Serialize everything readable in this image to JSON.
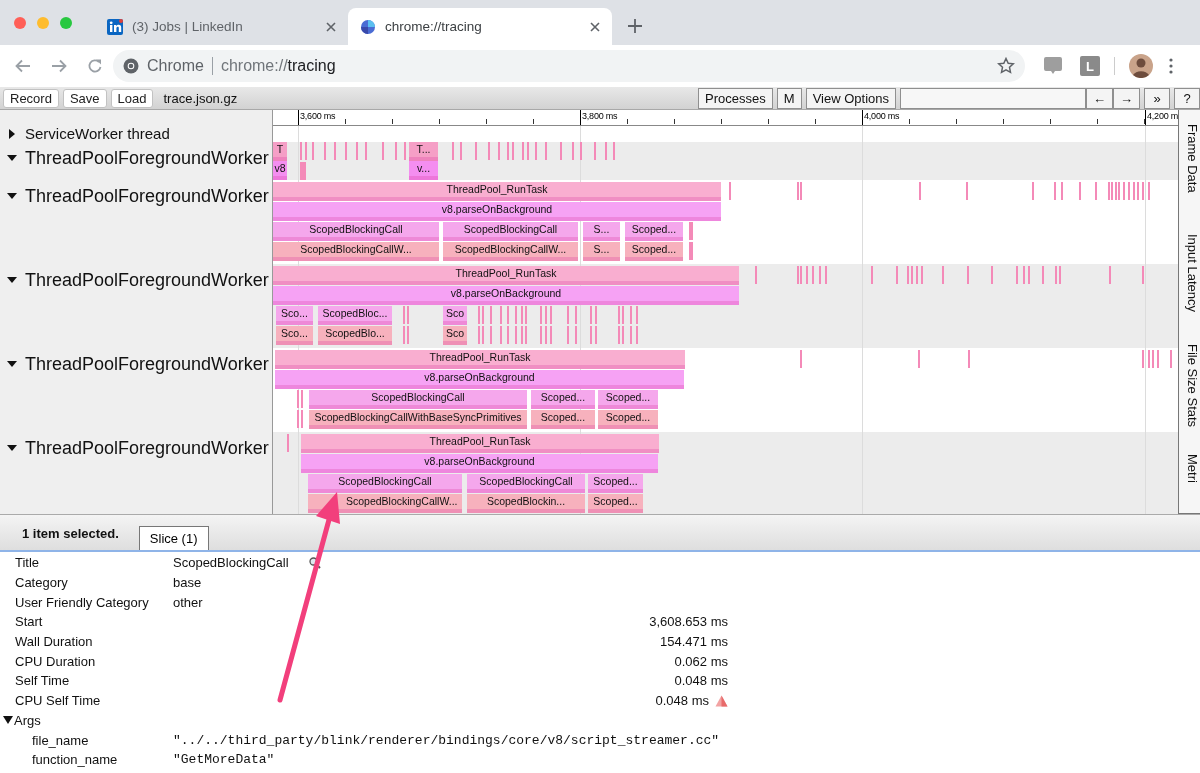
{
  "browser": {
    "tabs": [
      {
        "title": "(3) Jobs | LinkedIn",
        "selected": false
      },
      {
        "title": "chrome://tracing",
        "selected": true
      }
    ],
    "address": {
      "chip": "Chrome",
      "url_scheme": "chrome://",
      "url_path": "tracing"
    },
    "extension_label": "L"
  },
  "toolbar": {
    "buttons": [
      "Record",
      "Save",
      "Load"
    ],
    "file": "trace.json.gz",
    "right_buttons": [
      "Processes",
      "M",
      "View Options"
    ],
    "nav_buttons": [
      "←",
      "→",
      "»",
      "?"
    ]
  },
  "ruler": {
    "ticks": [
      "3,600 ms",
      "3,800 ms",
      "4,000 ms",
      "4,200 m"
    ]
  },
  "tracks": [
    {
      "name": "ServiceWorker thread",
      "expanded": false
    },
    {
      "name": "ThreadPoolForegroundWorker",
      "expanded": true,
      "rows": [
        {
          "slices": [
            {
              "label": "T",
              "color": "#f59fc6"
            },
            {
              "label": "T...",
              "color": "#f59fc6"
            }
          ]
        },
        {
          "slices": [
            {
              "label": "v8",
              "color": "#f48ef0"
            },
            {
              "label": "v...",
              "color": "#f48ef0"
            }
          ]
        }
      ]
    },
    {
      "name": "ThreadPoolForegroundWorker",
      "expanded": true,
      "rows": [
        {
          "slices": [
            {
              "label": "ThreadPool_RunTask",
              "color": "#f9aed0"
            }
          ]
        },
        {
          "slices": [
            {
              "label": "v8.parseOnBackground",
              "color": "#f6a2f4"
            }
          ]
        },
        {
          "slices": [
            {
              "label": "ScopedBlockingCall",
              "color": "#f5a7ec"
            },
            {
              "label": "ScopedBlockingCall",
              "color": "#f5a7ec"
            },
            {
              "label": "S...",
              "color": "#f5a7ec"
            },
            {
              "label": "Scoped...",
              "color": "#f5a7ec"
            }
          ]
        },
        {
          "slices": [
            {
              "label": "ScopedBlockingCallW...",
              "color": "#f7b1bd"
            },
            {
              "label": "ScopedBlockingCallW...",
              "color": "#f7b1bd"
            },
            {
              "label": "S...",
              "color": "#f7b1bd"
            },
            {
              "label": "Scoped...",
              "color": "#f7b1bd"
            }
          ]
        }
      ]
    },
    {
      "name": "ThreadPoolForegroundWorker",
      "expanded": true,
      "rows": [
        {
          "slices": [
            {
              "label": "ThreadPool_RunTask",
              "color": "#f9aed0"
            }
          ]
        },
        {
          "slices": [
            {
              "label": "v8.parseOnBackground",
              "color": "#f6a2f4"
            }
          ]
        },
        {
          "slices": [
            {
              "label": "Sco...",
              "color": "#f5a7ec"
            },
            {
              "label": "ScopedBloc...",
              "color": "#f5a7ec"
            },
            {
              "label": "Sco",
              "color": "#f5a7ec"
            }
          ]
        },
        {
          "slices": [
            {
              "label": "Sco...",
              "color": "#f7b1bd"
            },
            {
              "label": "ScopedBlo...",
              "color": "#f7b1bd"
            },
            {
              "label": "Sco",
              "color": "#f7b1bd"
            }
          ]
        }
      ]
    },
    {
      "name": "ThreadPoolForegroundWorker",
      "expanded": true,
      "rows": [
        {
          "slices": [
            {
              "label": "ThreadPool_RunTask",
              "color": "#f9aed0"
            }
          ]
        },
        {
          "slices": [
            {
              "label": "v8.parseOnBackground",
              "color": "#f6a2f4"
            }
          ]
        },
        {
          "slices": [
            {
              "label": "ScopedBlockingCall",
              "color": "#f5a7ec"
            },
            {
              "label": "Scoped...",
              "color": "#f5a7ec"
            },
            {
              "label": "Scoped...",
              "color": "#f5a7ec"
            }
          ]
        },
        {
          "slices": [
            {
              "label": "ScopedBlockingCallWithBaseSyncPrimitives",
              "color": "#f7b1bd"
            },
            {
              "label": "Scoped...",
              "color": "#f7b1bd"
            },
            {
              "label": "Scoped...",
              "color": "#f7b1bd"
            }
          ]
        }
      ]
    },
    {
      "name": "ThreadPoolForegroundWorker",
      "expanded": true,
      "rows": [
        {
          "slices": [
            {
              "label": "ThreadPool_RunTask",
              "color": "#f9aed0"
            }
          ]
        },
        {
          "slices": [
            {
              "label": "v8.parseOnBackground",
              "color": "#f6a2f4"
            }
          ]
        },
        {
          "slices": [
            {
              "label": "ScopedBlockingCall",
              "color": "#f5a7ec"
            },
            {
              "label": "ScopedBlockingCall",
              "color": "#f5a7ec"
            },
            {
              "label": "Scoped...",
              "color": "#f5a7ec"
            }
          ]
        },
        {
          "slices": [
            {
              "label": "ScopedBlockingCallW...",
              "color": "#f7b1bd"
            },
            {
              "label": "ScopedBlockin...",
              "color": "#f7b1bd"
            },
            {
              "label": "Scoped...",
              "color": "#f7b1bd"
            }
          ]
        }
      ]
    }
  ],
  "side_tabs": [
    {
      "label": "Frame Data",
      "selected": false
    },
    {
      "label": "Input Latency",
      "selected": false
    },
    {
      "label": "File Size Stats",
      "selected": false
    },
    {
      "label": "Metri",
      "selected": false
    }
  ],
  "panel": {
    "status": "1 item selected.",
    "tabs": [
      {
        "label": "Slice (1)",
        "selected": true
      }
    ],
    "fields": [
      {
        "label": "Title",
        "value": "ScopedBlockingCall",
        "kind": "title"
      },
      {
        "label": "Category",
        "value": "base",
        "kind": "text"
      },
      {
        "label": "User Friendly Category",
        "value": "other",
        "kind": "text"
      },
      {
        "label": "Start",
        "value": "3,608.653 ms",
        "kind": "number"
      },
      {
        "label": "Wall Duration",
        "value": "154.471 ms",
        "kind": "number"
      },
      {
        "label": "CPU Duration",
        "value": "0.062 ms",
        "kind": "number"
      },
      {
        "label": "Self Time",
        "value": "0.048 ms",
        "kind": "number"
      },
      {
        "label": "CPU Self Time",
        "value": "0.048 ms",
        "kind": "number",
        "warning": true
      }
    ],
    "args": {
      "label": "Args",
      "expanded": true,
      "items": [
        {
          "label": "file_name",
          "value": "\"../../third_party/blink/renderer/bindings/core/v8/script_streamer.cc\""
        },
        {
          "label": "function_name",
          "value": "\"GetMoreData\""
        }
      ]
    }
  }
}
